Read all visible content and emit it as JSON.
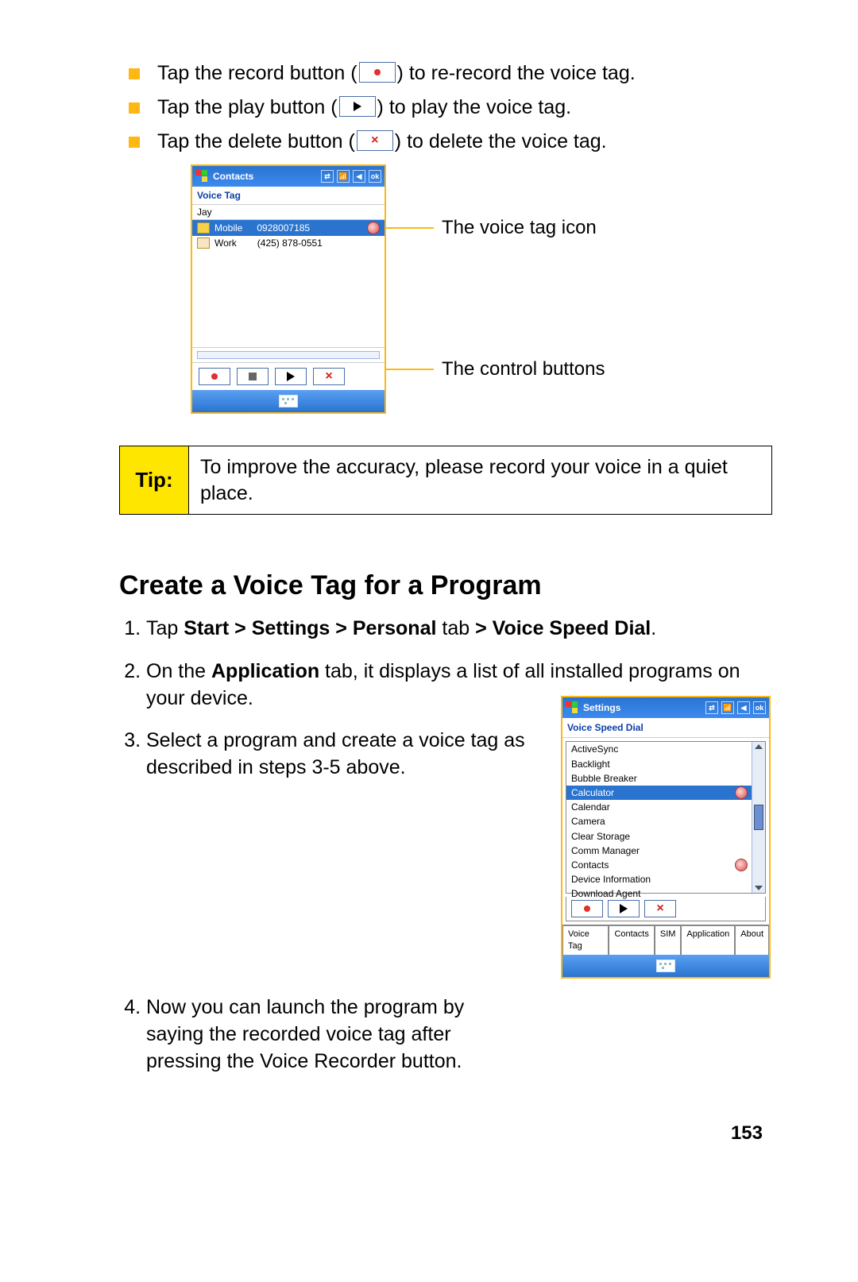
{
  "bullets": [
    {
      "pre": "Tap the record button (",
      "post": ") to re-record the voice tag."
    },
    {
      "pre": "Tap the play button (",
      "post": ") to play the voice tag."
    },
    {
      "pre": "Tap the delete button (",
      "post": ") to delete the voice tag."
    }
  ],
  "screenshot1": {
    "title": "Contacts",
    "ok": "ok",
    "subheading": "Voice Tag",
    "contactName": "Jay",
    "entries": [
      {
        "label": "Mobile",
        "number": "0928007185",
        "selected": true,
        "hasVoice": true
      },
      {
        "label": "Work",
        "number": "(425) 878-0551",
        "selected": false,
        "hasVoice": false
      }
    ]
  },
  "callouts": {
    "icon": "The voice tag icon",
    "controls": "The control buttons"
  },
  "tip": {
    "label": "Tip:",
    "text": "To improve the accuracy, please record your voice in a quiet place."
  },
  "sectionTitle": "Create a Voice Tag for a Program",
  "steps": {
    "s1_pre": "Tap ",
    "s1_bold": "Start > Settings > Personal",
    "s1_mid": " tab ",
    "s1_bold2": "> Voice Speed Dial",
    "s1_post": ".",
    "s2_pre": "On the ",
    "s2_bold": "Application",
    "s2_post": " tab, it displays a list of all installed programs on your device.",
    "s3": "Select a program and create a voice tag as described in steps 3-5 above.",
    "s4": "Now you can launch the program by saying the recorded voice tag after pressing the Voice Recorder button."
  },
  "screenshot2": {
    "title": "Settings",
    "ok": "ok",
    "subheading": "Voice Speed Dial",
    "items": [
      {
        "label": "ActiveSync"
      },
      {
        "label": "Backlight"
      },
      {
        "label": "Bubble Breaker"
      },
      {
        "label": "Calculator",
        "selected": true,
        "hasVoice": true
      },
      {
        "label": "Calendar"
      },
      {
        "label": "Camera"
      },
      {
        "label": "Clear Storage"
      },
      {
        "label": "Comm Manager"
      },
      {
        "label": "Contacts",
        "hasVoice": true
      },
      {
        "label": "Device Information"
      },
      {
        "label": "Download Agent"
      }
    ],
    "tabs": [
      "Voice Tag",
      "Contacts",
      "SIM",
      "Application",
      "About"
    ]
  },
  "pageNumber": "153"
}
